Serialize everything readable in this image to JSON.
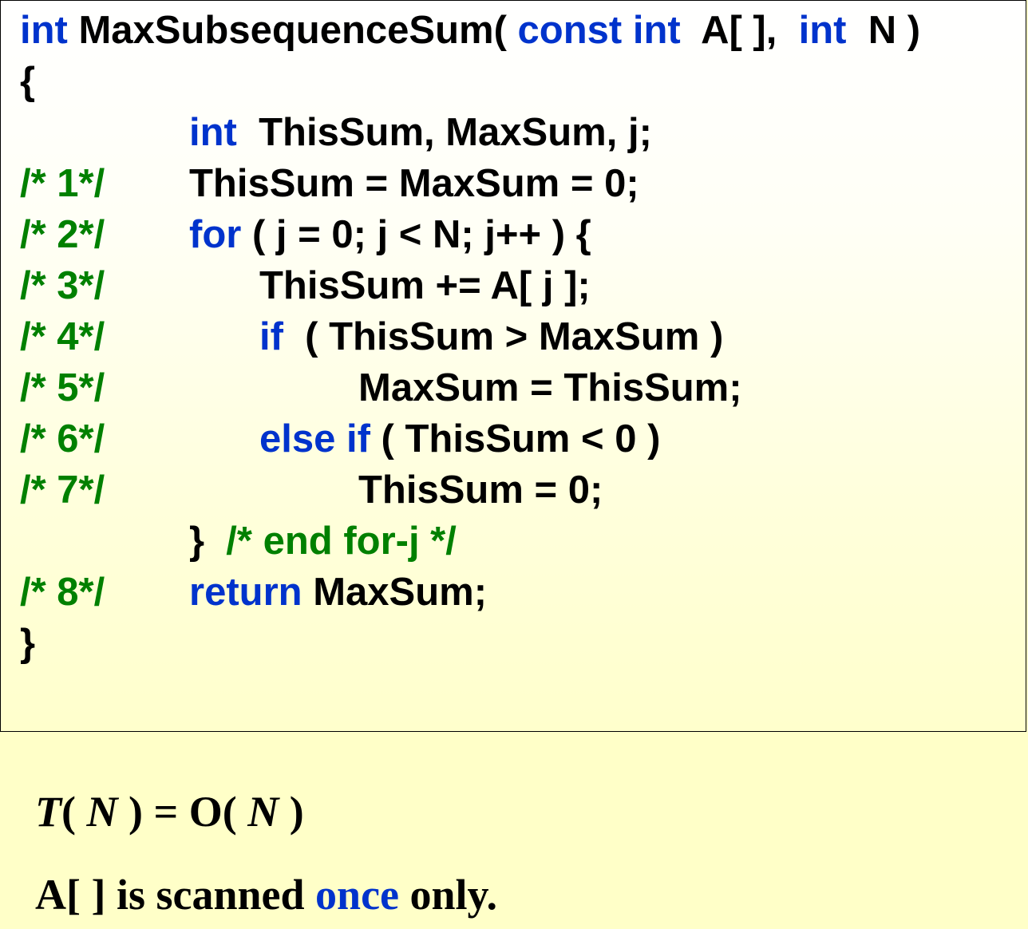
{
  "code": {
    "signature": {
      "kw1": "int",
      "name": " MaxSubsequenceSum( ",
      "kw2": "const int",
      "param1": "  A[ ],  ",
      "kw3": "int",
      "param2": "  N )"
    },
    "open_brace": "{",
    "decl": {
      "kw": "int",
      "rest": "  ThisSum, MaxSum, j;"
    },
    "line1": {
      "no": "/* 1*/",
      "text": "ThisSum = MaxSum = 0;"
    },
    "line2": {
      "no": "/* 2*/",
      "kw": "for",
      "rest": " ( j = 0; j < N; j++ ) {"
    },
    "line3": {
      "no": "/* 3*/",
      "text": "ThisSum += A[ j ];"
    },
    "line4": {
      "no": "/* 4*/",
      "kw": "if",
      "rest": "  ( ThisSum > MaxSum )"
    },
    "line5": {
      "no": "/* 5*/",
      "text": "MaxSum = ThisSum;"
    },
    "line6": {
      "no": "/* 6*/",
      "kw": "else if",
      "rest": " ( ThisSum < 0 )"
    },
    "line7": {
      "no": "/* 7*/",
      "text": "ThisSum = 0;"
    },
    "end_for": {
      "brace": "}  ",
      "comment": "/* end for-j */"
    },
    "line8": {
      "no": "/* 8*/",
      "kw": "return",
      "rest": " MaxSum;"
    },
    "close_brace": "}"
  },
  "notes": {
    "complexity": {
      "T": "T",
      "open": "( ",
      "N1": "N",
      "mid": " ) = O( ",
      "N2": "N",
      "close": " )"
    },
    "scan": {
      "before": "A[ ] is scanned ",
      "highlight": "once",
      "after": " only."
    }
  },
  "colors": {
    "keyword": "#0033CC",
    "comment": "#008000",
    "text": "#000000",
    "background": "#FFFFC8"
  }
}
